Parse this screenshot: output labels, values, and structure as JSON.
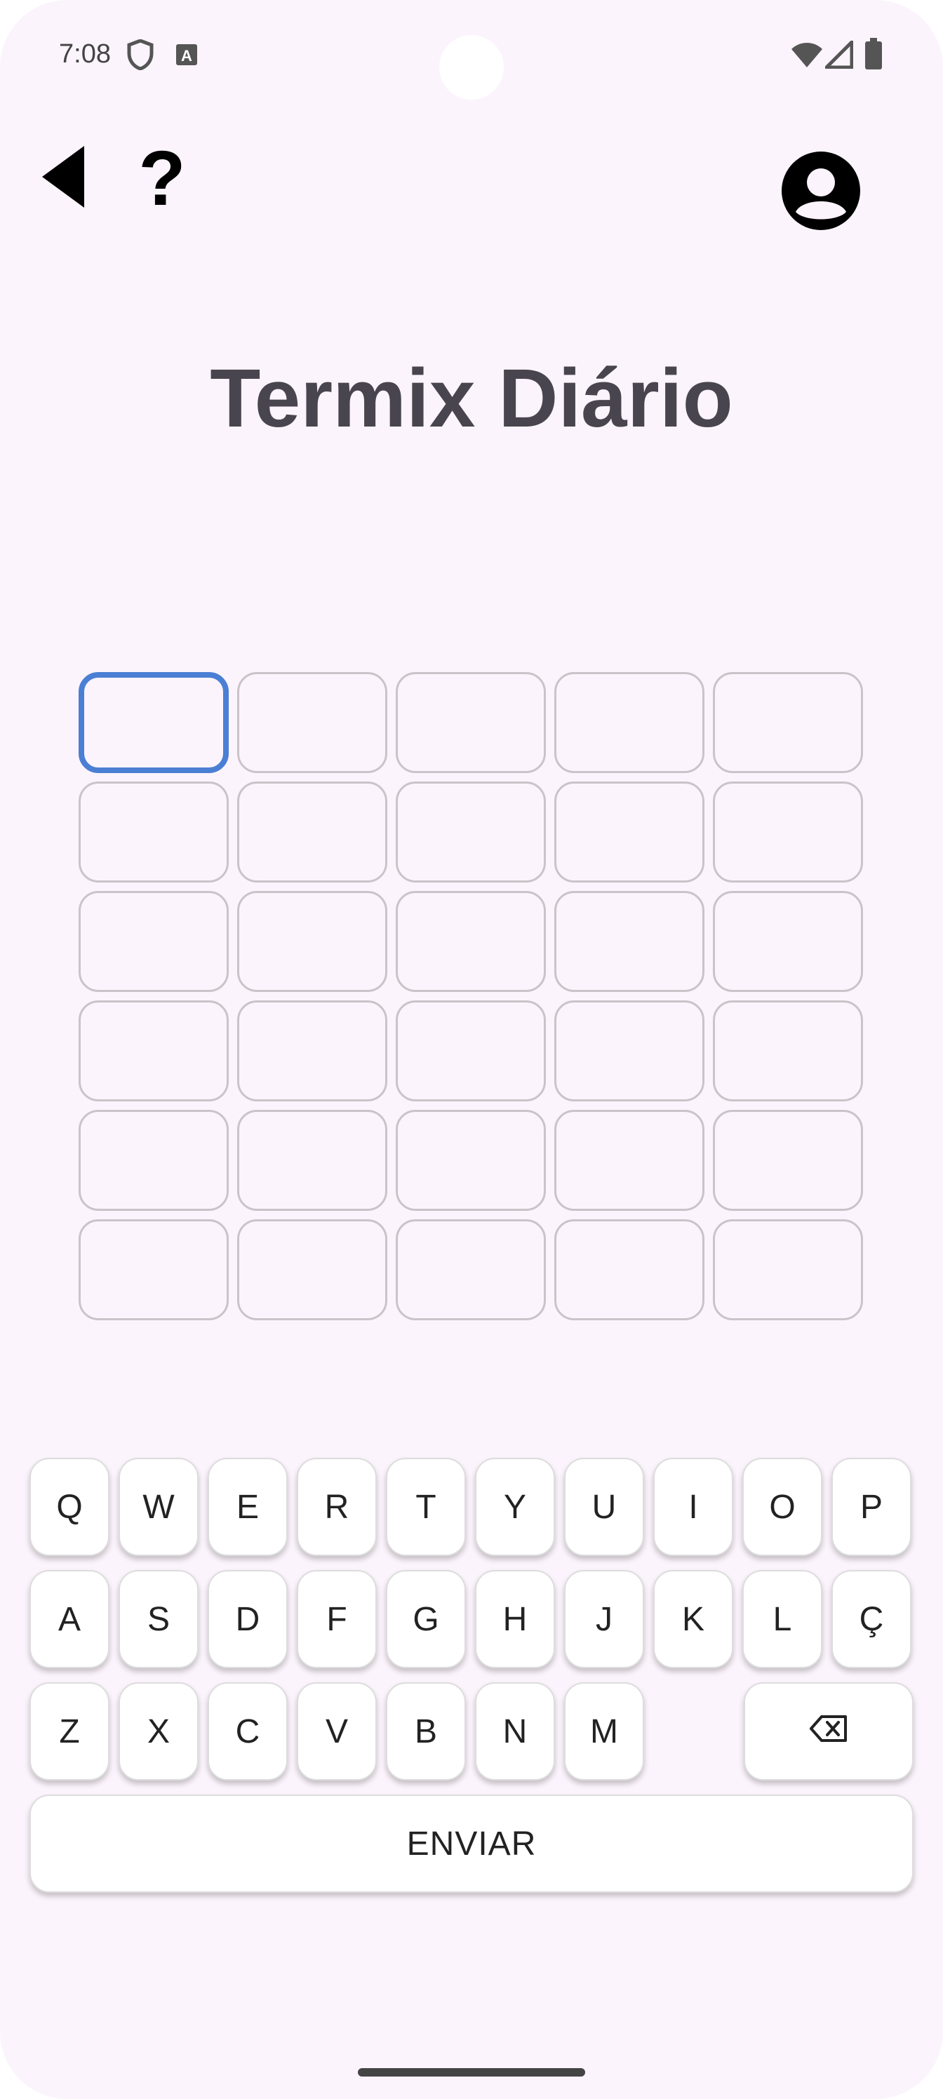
{
  "status_bar": {
    "time": "7:08",
    "icons": [
      "shield-icon",
      "a-badge-icon",
      "wifi-icon",
      "signal-icon",
      "battery-icon"
    ]
  },
  "top_bar": {
    "icons": [
      "back-triangle-icon",
      "help-question-icon",
      "account-circle-icon"
    ]
  },
  "title": "Termix Diário",
  "grid": {
    "rows": 6,
    "cols": 5,
    "active_cell": [
      0,
      0
    ]
  },
  "keyboard": {
    "row1": [
      "Q",
      "W",
      "E",
      "R",
      "T",
      "Y",
      "U",
      "I",
      "O",
      "P"
    ],
    "row2": [
      "A",
      "S",
      "D",
      "F",
      "G",
      "H",
      "J",
      "K",
      "L",
      "Ç"
    ],
    "row3": [
      "Z",
      "X",
      "C",
      "V",
      "B",
      "N",
      "M"
    ],
    "backspace_icon": "backspace-icon",
    "enter_label": "ENVIAR"
  },
  "colors": {
    "background": "#fcf4fc",
    "title": "#49454f",
    "active_cell_border": "#4a7fd4",
    "cell_border": "#c9c4c9"
  }
}
